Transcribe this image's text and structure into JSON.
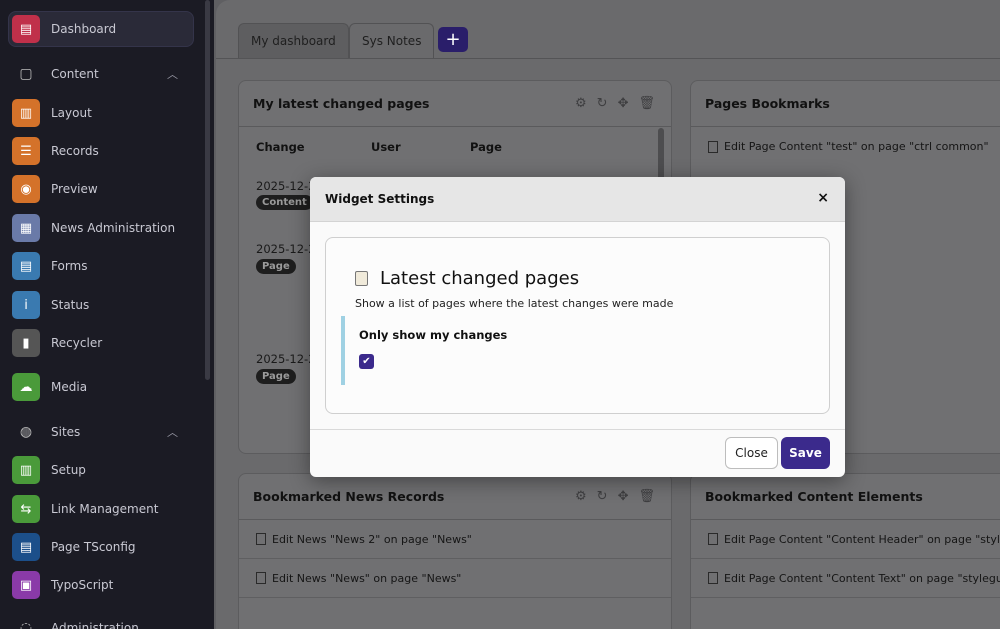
{
  "sidebar": {
    "items": [
      {
        "label": "Dashboard",
        "icon": "dashboard-icon",
        "color": "#c0304a",
        "glyph": "▤"
      },
      {
        "label": "Content",
        "icon": "content-icon",
        "glyph": "▢",
        "section": true
      },
      {
        "label": "Layout",
        "icon": "layout-icon",
        "color": "#d4722a",
        "glyph": "▥"
      },
      {
        "label": "Records",
        "icon": "records-icon",
        "color": "#d4722a",
        "glyph": "☰"
      },
      {
        "label": "Preview",
        "icon": "preview-icon",
        "color": "#d4722a",
        "glyph": "◉"
      },
      {
        "label": "News Administration",
        "icon": "news-icon",
        "color": "#6a7aa8",
        "glyph": "▦"
      },
      {
        "label": "Forms",
        "icon": "forms-icon",
        "color": "#3a7ab0",
        "glyph": "▤"
      },
      {
        "label": "Status",
        "icon": "status-icon",
        "color": "#3a7ab0",
        "glyph": "i"
      },
      {
        "label": "Recycler",
        "icon": "recycler-icon",
        "color": "#555",
        "glyph": "▮"
      },
      {
        "label": "Media",
        "icon": "media-icon",
        "color": "#4a9a3a",
        "glyph": "☁"
      },
      {
        "label": "Sites",
        "icon": "sites-icon",
        "glyph": "◍",
        "section": true
      },
      {
        "label": "Setup",
        "icon": "setup-icon",
        "color": "#4a9a3a",
        "glyph": "▥"
      },
      {
        "label": "Link Management",
        "icon": "link-icon",
        "color": "#4a9a3a",
        "glyph": "⇆"
      },
      {
        "label": "Page TSconfig",
        "icon": "tsconfig-icon",
        "color": "#1c4f8a",
        "glyph": "▤"
      },
      {
        "label": "TypoScript",
        "icon": "typoscript-icon",
        "color": "#8a3aa8",
        "glyph": "▣"
      },
      {
        "label": "Administration",
        "icon": "admin-icon",
        "glyph": "◌",
        "section": true
      }
    ]
  },
  "tabs": {
    "tab1": "My dashboard",
    "tab2": "Sys Notes",
    "add": "+"
  },
  "widgets": {
    "latest": {
      "title": "My latest changed pages",
      "headers": [
        "Change",
        "User",
        "Page"
      ],
      "rows": [
        {
          "date": "2025-12-2",
          "tag": "Content"
        },
        {
          "date": "2025-12-2",
          "tag": "Page"
        },
        {
          "date": "2025-12-2",
          "tag": "Page"
        }
      ]
    },
    "bookmarks": {
      "title": "Pages Bookmarks",
      "rows": [
        "Edit Page Content \"test\" on page \"ctrl common\""
      ]
    },
    "news": {
      "title": "Bookmarked News Records",
      "rows": [
        "Edit News \"News 2\" on page \"News\"",
        "Edit News \"News\" on page \"News\""
      ]
    },
    "content": {
      "title": "Bookmarked Content Elements",
      "rows": [
        "Edit Page Content \"Content Header\" on page \"style",
        "Edit Page Content \"Content Text\" on page \"stylegui"
      ]
    }
  },
  "modal": {
    "title": "Widget Settings",
    "close_x": "×",
    "widget_title": "Latest changed pages",
    "description": "Show a list of pages where the latest changes were made",
    "option_label": "Only show my changes",
    "option_checked": true,
    "close_button": "Close",
    "save_button": "Save"
  },
  "colors": {
    "accent": "#3b2a8c",
    "option_bar": "#9fd1e3"
  }
}
